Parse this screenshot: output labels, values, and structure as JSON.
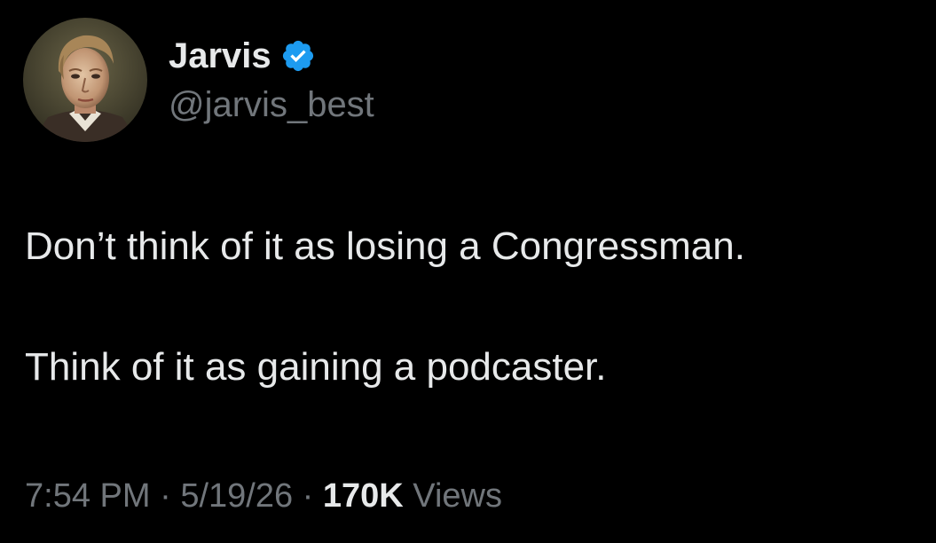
{
  "author": {
    "display_name": "Jarvis",
    "handle": "@jarvis_best",
    "verified": true,
    "avatar_icon": "portrait-painting-avatar",
    "verified_icon": "verified-badge-icon",
    "verified_color": "#1d9bf0"
  },
  "tweet": {
    "lines": [
      "Don’t think of it as losing a Congressman.",
      "Think of it as gaining a podcaster."
    ]
  },
  "meta": {
    "time": "7:54 PM",
    "separator": "·",
    "date": "5/19/26",
    "views_count": "170K",
    "views_label": "Views"
  },
  "colors": {
    "background": "#000000",
    "primary_text": "#e7e9ea",
    "secondary_text": "#71767b"
  }
}
